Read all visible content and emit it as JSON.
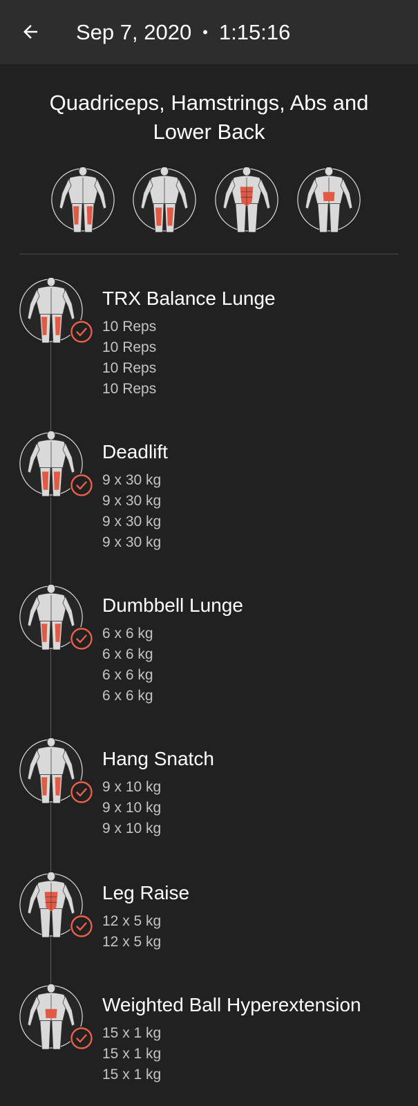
{
  "header": {
    "back_icon": "arrow-left-icon",
    "date": "Sep 7, 2020",
    "separator": "•",
    "duration": "1:15:16"
  },
  "workout": {
    "title": "Quadriceps, Hamstrings, Abs and Lower Back",
    "muscle_groups": [
      {
        "icon": "quadriceps-front-body-icon",
        "view": "front",
        "highlight": "quads"
      },
      {
        "icon": "hamstrings-back-body-icon",
        "view": "back",
        "highlight": "hamstrings"
      },
      {
        "icon": "abs-front-body-icon",
        "view": "front",
        "highlight": "abs"
      },
      {
        "icon": "lower-back-body-icon",
        "view": "back",
        "highlight": "lowerback"
      }
    ]
  },
  "colors": {
    "background": "#212121",
    "header": "#2d2d2d",
    "accent": "#e8604c",
    "muscle_highlight": "#e05a45",
    "secondary_text": "#c4c4c4"
  },
  "exercises": [
    {
      "name": "TRX Balance Lunge",
      "icon": "quadriceps-front-body-icon",
      "view": "front",
      "highlight": "quads",
      "completed": true,
      "sets": [
        "10 Reps",
        "10 Reps",
        "10 Reps",
        "10 Reps"
      ]
    },
    {
      "name": "Deadlift",
      "icon": "hamstrings-back-body-icon",
      "view": "back",
      "highlight": "hamstrings",
      "completed": true,
      "sets": [
        "9 x 30 kg",
        "9 x 30 kg",
        "9 x 30 kg",
        "9 x 30 kg"
      ]
    },
    {
      "name": "Dumbbell Lunge",
      "icon": "quadriceps-front-body-icon",
      "view": "front",
      "highlight": "quads",
      "completed": true,
      "sets": [
        "6 x 6 kg",
        "6 x 6 kg",
        "6 x 6 kg",
        "6 x 6 kg"
      ]
    },
    {
      "name": "Hang Snatch",
      "icon": "quadriceps-front-body-icon",
      "view": "front",
      "highlight": "quads",
      "completed": true,
      "sets": [
        "9 x 10 kg",
        "9 x 10 kg",
        "9 x 10 kg"
      ]
    },
    {
      "name": "Leg Raise",
      "icon": "abs-front-body-icon",
      "view": "front",
      "highlight": "abs",
      "completed": true,
      "sets": [
        "12 x 5 kg",
        "12 x 5 kg"
      ]
    },
    {
      "name": "Weighted Ball Hyperextension",
      "icon": "lower-back-body-icon",
      "view": "back",
      "highlight": "lowerback",
      "completed": true,
      "sets": [
        "15 x 1 kg",
        "15 x 1 kg",
        "15 x 1 kg"
      ]
    }
  ]
}
